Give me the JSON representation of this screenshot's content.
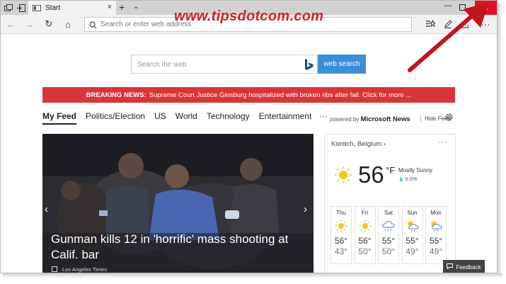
{
  "titlebar": {
    "tab_title": "Start",
    "tab_close": "×",
    "new_tab": "+",
    "tab_menu": "⌄",
    "minimize": "—",
    "close": "×"
  },
  "watermark": "www.tipsdotcom.com",
  "navbar": {
    "back": "←",
    "forward": "→",
    "refresh": "↻",
    "home": "⌂",
    "address_placeholder": "Search or enter web address",
    "more": "···"
  },
  "search": {
    "placeholder": "Search the web",
    "button_label": "web search"
  },
  "breaking_news": {
    "label": "BREAKING NEWS:",
    "text": "Supreme Court Justice Ginsburg hospitalized with broken ribs after fall. Click for more ..."
  },
  "feed": {
    "tabs": [
      "My Feed",
      "Politics/Election",
      "US",
      "World",
      "Technology",
      "Entertainment"
    ],
    "more": "···",
    "powered_by_prefix": "powered by",
    "powered_by_brand": "Microsoft News",
    "hide_feed": "Hide Feed"
  },
  "hero": {
    "title": "Gunman kills 12 in 'horrific' mass shooting at Calif. bar",
    "source": "Los Angeles Times",
    "prev": "‹",
    "next": "›"
  },
  "weather": {
    "location": "Kontich, Belgium ›",
    "more": "···",
    "temp": "56",
    "unit": "°F",
    "condition": "Mostly Sunny",
    "precip": "0.0%",
    "forecast": [
      {
        "day": "Thu",
        "hi": "56°",
        "lo": "43°",
        "icon": "sun-icon"
      },
      {
        "day": "Fri",
        "hi": "56°",
        "lo": "50°",
        "icon": "sun-icon"
      },
      {
        "day": "Sat",
        "hi": "55°",
        "lo": "50°",
        "icon": "rain-cloud-icon"
      },
      {
        "day": "Sun",
        "hi": "55°",
        "lo": "49°",
        "icon": "partly-sunny-rain-icon"
      },
      {
        "day": "Mon",
        "hi": "55°",
        "lo": "49°",
        "icon": "partly-sunny-rain-icon"
      }
    ]
  },
  "feedback": {
    "icon": "feedback-icon",
    "label": "Feedback"
  },
  "colors": {
    "close_button": "#e81123",
    "breaking_bar": "#d9343a",
    "search_button": "#3b8fd8",
    "watermark": "#d21f26"
  }
}
